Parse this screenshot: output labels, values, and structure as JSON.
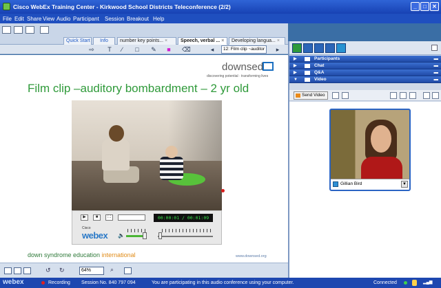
{
  "window": {
    "title": "Cisco WebEx Training Center - Kirkwood School Districts Teleconference (2/2)",
    "controls": [
      "_",
      "□",
      "✕"
    ]
  },
  "menu": [
    "File",
    "Edit",
    "Share",
    "View",
    "Audio",
    "Participant",
    "Session",
    "Breakout",
    "Help"
  ],
  "tabs": [
    {
      "label": "Quick Start",
      "active": false
    },
    {
      "label": "Info",
      "active": false
    },
    {
      "label": "number key points...",
      "active": false
    },
    {
      "label": "Speech, verbal ...",
      "active": true
    },
    {
      "label": "Developing langua...",
      "active": false
    }
  ],
  "toolbar": {
    "page_select": "12: Film clip ~auditor"
  },
  "slide": {
    "brand": "downsed",
    "tagline": "discovering potential · transforming lives",
    "title": "Film clip –auditory bombardment – 2 yr old",
    "footer_left_main": "down syndrome education",
    "footer_left_accent": "international",
    "footer_right": "www.downsed.org"
  },
  "player": {
    "time": "00:00:01 / 00:01:09",
    "logo_top": "Cisco",
    "logo": "webex",
    "volume_fraction": 0.9,
    "seek_fraction": 0.014
  },
  "bottombar": {
    "zoom": "64%"
  },
  "panels": [
    {
      "label": "Participants",
      "expanded": false
    },
    {
      "label": "Chat",
      "expanded": false
    },
    {
      "label": "Q&A",
      "expanded": false
    },
    {
      "label": "Video",
      "expanded": true
    }
  ],
  "video_panel": {
    "send_video": "Send Video",
    "participant_name": "Gillian Bird"
  },
  "status": {
    "logo": "webex",
    "recording": "Recording",
    "session": "Session No. 840 797 094",
    "audio_msg": "You are participating in this audio conference using your computer.",
    "connected": "Connected"
  },
  "colors": {
    "title_green": "#2f9a3a",
    "accent_orange": "#e08a16",
    "webex_blue": "#2a79c7",
    "recording_red": "#e02020",
    "connected_green": "#3fd14a"
  }
}
